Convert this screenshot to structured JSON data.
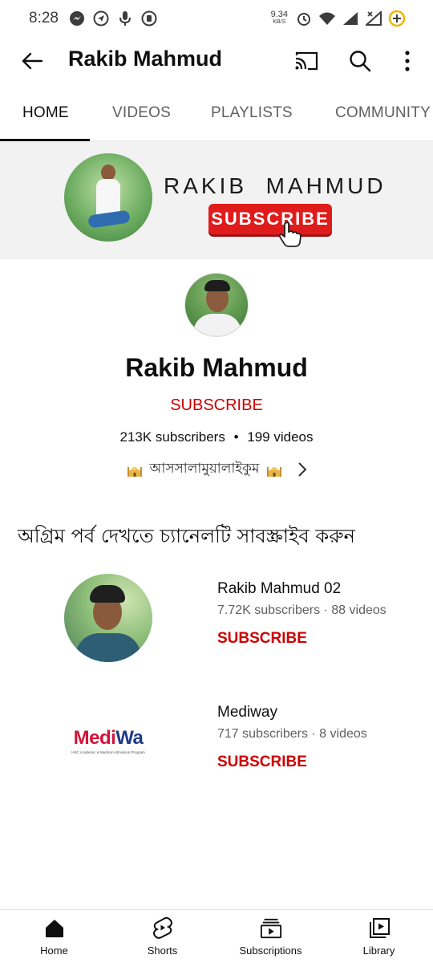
{
  "status_bar": {
    "time": "8:28",
    "net_speed_value": "9.34",
    "net_speed_unit": "KB/S"
  },
  "app_bar": {
    "title": "Rakib Mahmud",
    "back_icon": "arrow-left-icon",
    "cast_icon": "cast-icon",
    "search_icon": "search-icon",
    "more_icon": "more-vertical-icon"
  },
  "tabs": [
    {
      "label": "HOME",
      "active": true
    },
    {
      "label": "VIDEOS",
      "active": false
    },
    {
      "label": "PLAYLISTS",
      "active": false
    },
    {
      "label": "COMMUNITY",
      "active": false
    }
  ],
  "banner": {
    "name": "RAKIB  MAHMUD",
    "subscribe_label": "SUBSCRIBE"
  },
  "channel": {
    "name": "Rakib Mahmud",
    "subscribe_label": "SUBSCRIBE",
    "subscribers": "213K subscribers",
    "separator": "•",
    "videos": "199 videos",
    "about_text": "আসসালামুয়ালাইকুম"
  },
  "featured": {
    "title": "অগ্রিম পর্ব দেখতে চ্যানেলটি সাবস্ক্রাইব করুন",
    "channels": [
      {
        "name": "Rakib Mahmud 02",
        "stats": "7.72K subscribers · 88 videos",
        "subscribe_label": "SUBSCRIBE"
      },
      {
        "name": "Mediway",
        "stats": "717 subscribers · 8 videos",
        "subscribe_label": "SUBSCRIBE",
        "logo_part1": "Medi",
        "logo_part2": "Wa",
        "logo_tagline": "HSC Academic & Medical Admission Program"
      }
    ]
  },
  "bottom_nav": [
    {
      "label": "Home",
      "icon": "home-icon"
    },
    {
      "label": "Shorts",
      "icon": "shorts-icon"
    },
    {
      "label": "Subscriptions",
      "icon": "subscriptions-icon"
    },
    {
      "label": "Library",
      "icon": "library-icon"
    }
  ],
  "colors": {
    "accent_red": "#cc0000",
    "text_primary": "#0f0f0f",
    "text_secondary": "#606060"
  }
}
